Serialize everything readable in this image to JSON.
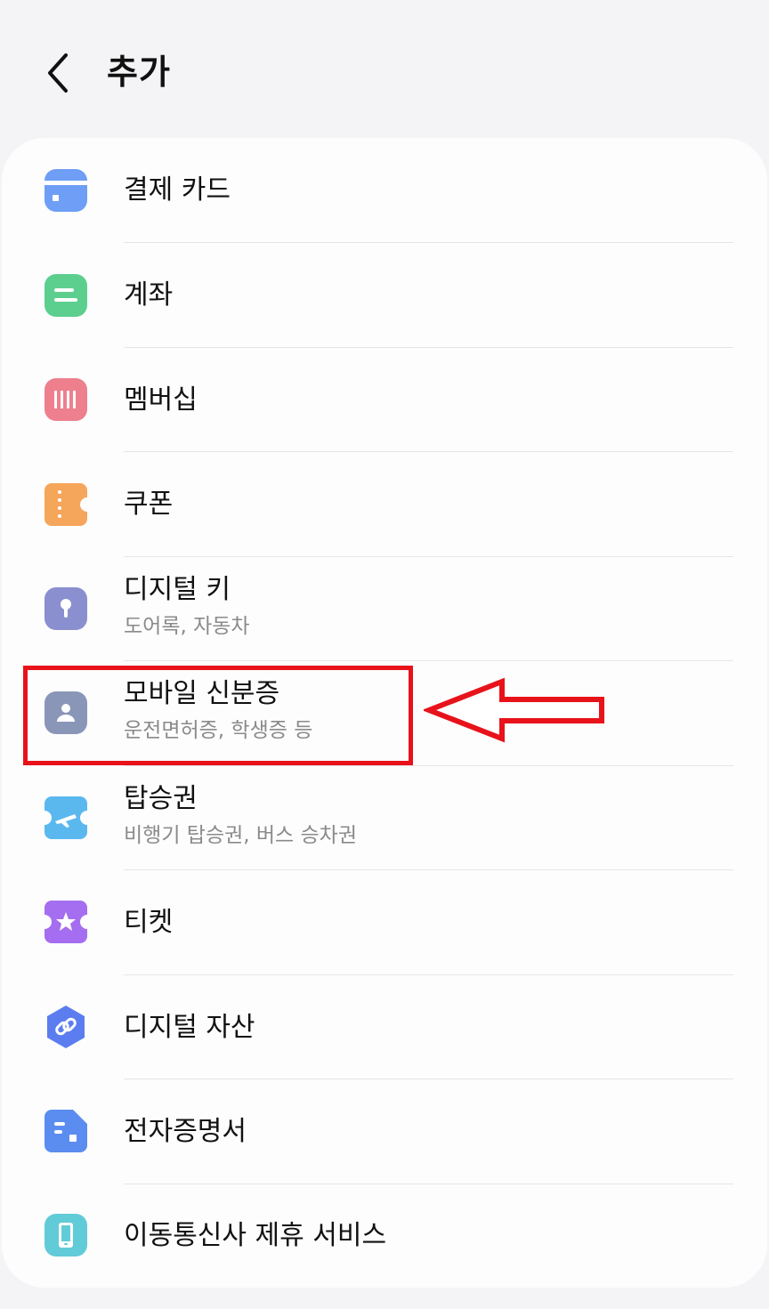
{
  "header": {
    "title": "추가",
    "back_icon": "chevron-left-icon"
  },
  "items": [
    {
      "title": "결제 카드",
      "subtitle": "",
      "icon": "credit-card-icon",
      "color": "#6e9ef5"
    },
    {
      "title": "계좌",
      "subtitle": "",
      "icon": "bank-account-icon",
      "color": "#5ccf8e"
    },
    {
      "title": "멤버십",
      "subtitle": "",
      "icon": "barcode-icon",
      "color": "#ee7f8d"
    },
    {
      "title": "쿠폰",
      "subtitle": "",
      "icon": "coupon-icon",
      "color": "#f5a65b"
    },
    {
      "title": "디지털 키",
      "subtitle": "도어록, 자동차",
      "icon": "key-icon",
      "color": "#8a8fd0"
    },
    {
      "title": "모바일 신분증",
      "subtitle": "운전면허증, 학생증 등",
      "icon": "id-card-icon",
      "color": "#8a96b8"
    },
    {
      "title": "탑승권",
      "subtitle": "비행기 탑승권, 버스 승차권",
      "icon": "airplane-ticket-icon",
      "color": "#5bb8ef"
    },
    {
      "title": "티켓",
      "subtitle": "",
      "icon": "star-ticket-icon",
      "color": "#a56ef0"
    },
    {
      "title": "디지털 자산",
      "subtitle": "",
      "icon": "chain-link-icon",
      "color": "#5b7df0"
    },
    {
      "title": "전자증명서",
      "subtitle": "",
      "icon": "document-icon",
      "color": "#5b8cf0"
    },
    {
      "title": "이동통신사 제휴 서비스",
      "subtitle": "",
      "icon": "mobile-phone-icon",
      "color": "#62cbd8"
    }
  ],
  "annotation": {
    "highlight_color": "#e8121a",
    "highlighted_item": "모바일 신분증"
  }
}
